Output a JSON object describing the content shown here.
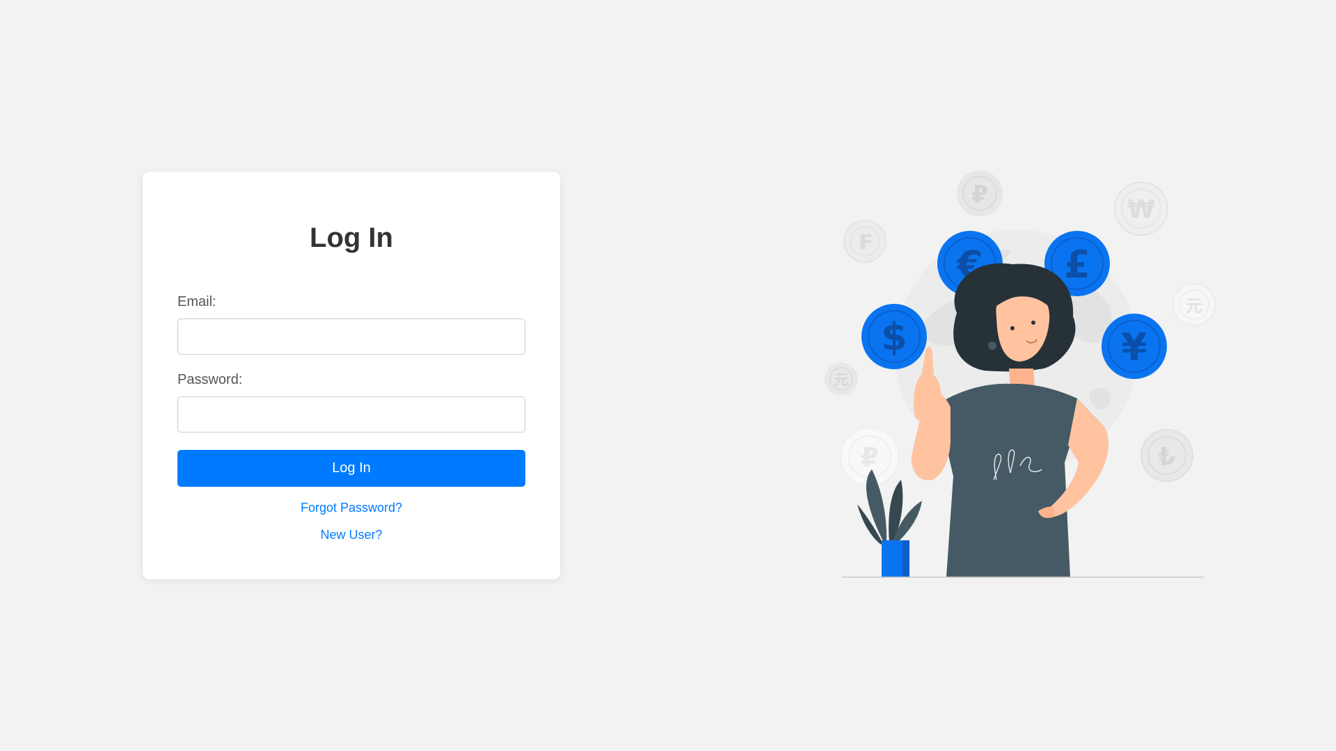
{
  "login": {
    "title": "Log In",
    "email_label": "Email:",
    "email_value": "",
    "password_label": "Password:",
    "password_value": "",
    "submit_label": "Log In",
    "forgot_password_link": "Forgot Password?",
    "new_user_link": "New User?"
  },
  "illustration": {
    "subject": "woman-pointing-up-with-currency-coins",
    "coin_symbols": [
      "€",
      "£",
      "$",
      "¥"
    ],
    "faded_coin_symbols": [
      "₽",
      "₩",
      "₣",
      "元",
      "元",
      "₽",
      "₺"
    ]
  },
  "colors": {
    "background": "#f2f2f2",
    "card": "#ffffff",
    "accent": "#007bff",
    "title_text": "#333333",
    "label_text": "#555555",
    "coin_blue": "#0a74f0",
    "shirt": "#455a64",
    "skin": "#ffc3a0",
    "hair": "#263238"
  }
}
